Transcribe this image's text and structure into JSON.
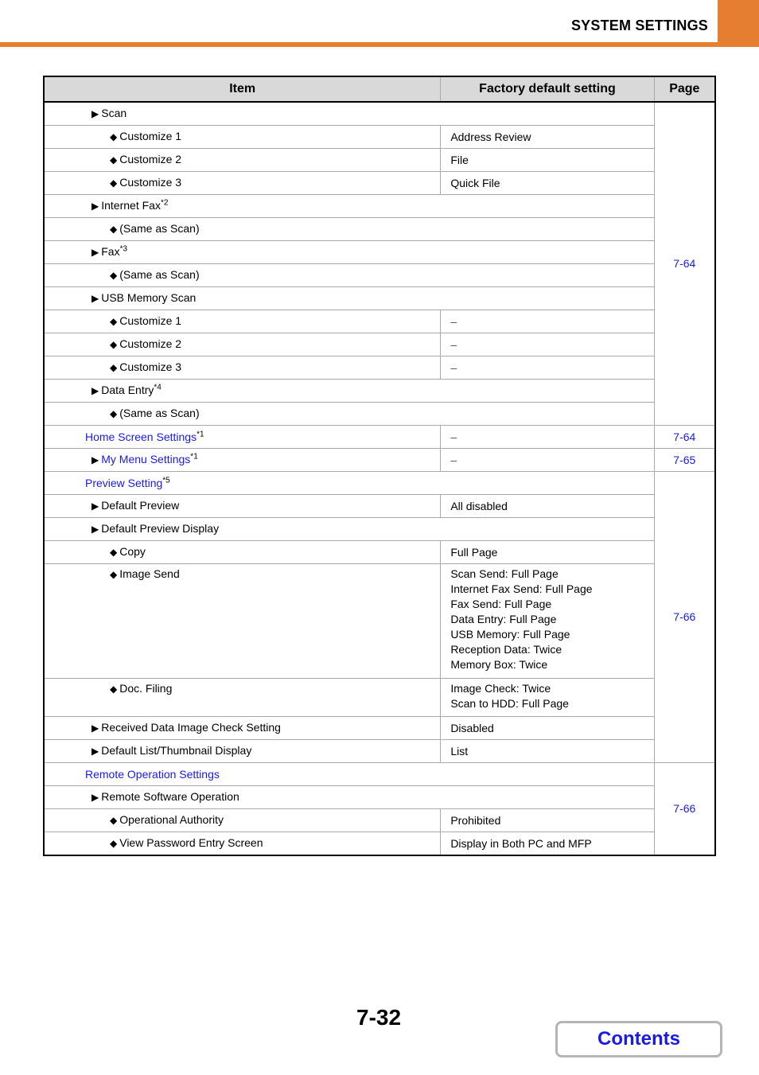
{
  "header": {
    "section_title": "SYSTEM SETTINGS",
    "accent_color": "#E67E31"
  },
  "table": {
    "columns": [
      "Item",
      "Factory default setting",
      "Page"
    ],
    "link_color": "#1A1AE6",
    "rows": [
      {
        "item": "Scan",
        "marker": "▶",
        "level": 1,
        "default": null,
        "page": "7-64"
      },
      {
        "item": "Customize 1",
        "marker": "◆",
        "level": 2,
        "default": "Address Review"
      },
      {
        "item": "Customize 2",
        "marker": "◆",
        "level": 2,
        "default": "File"
      },
      {
        "item": "Customize 3",
        "marker": "◆",
        "level": 2,
        "default": "Quick File"
      },
      {
        "item": "Internet Fax",
        "sup": "*2",
        "marker": "▶",
        "level": 1,
        "default": null
      },
      {
        "item": "(Same as Scan)",
        "marker": "◆",
        "level": 2,
        "default": null
      },
      {
        "item": "Fax",
        "sup": "*3",
        "marker": "▶",
        "level": 1,
        "default": null
      },
      {
        "item": "(Same as Scan)",
        "marker": "◆",
        "level": 2,
        "default": null
      },
      {
        "item": "USB Memory Scan",
        "marker": "▶",
        "level": 1,
        "default": null
      },
      {
        "item": "Customize 1",
        "marker": "◆",
        "level": 2,
        "default": "–"
      },
      {
        "item": "Customize 2",
        "marker": "◆",
        "level": 2,
        "default": "–"
      },
      {
        "item": "Customize 3",
        "marker": "◆",
        "level": 2,
        "default": "–"
      },
      {
        "item": "Data Entry",
        "sup": "*4",
        "marker": "▶",
        "level": 1,
        "default": null
      },
      {
        "item": "(Same as Scan)",
        "marker": "◆",
        "level": 2,
        "default": null
      },
      {
        "item": "Home Screen Settings",
        "sup": "*1",
        "level": 0,
        "link": true,
        "default": "–",
        "page": "7-64"
      },
      {
        "item": "My Menu Settings",
        "sup": "*1",
        "marker": "▶",
        "level": 1,
        "link": true,
        "default": "–",
        "page": "7-65"
      },
      {
        "item": "Preview Setting",
        "sup": "*5",
        "level": 0,
        "link": true,
        "default": null,
        "page": "7-66"
      },
      {
        "item": "Default Preview",
        "marker": "▶",
        "level": 1,
        "default": "All disabled"
      },
      {
        "item": "Default Preview Display",
        "marker": "▶",
        "level": 1,
        "default": null
      },
      {
        "item": "Copy",
        "marker": "◆",
        "level": 2,
        "default": "Full Page"
      },
      {
        "item": "Image Send",
        "marker": "◆",
        "level": 2,
        "default_lines": [
          "Scan Send: Full Page",
          "Internet Fax Send: Full Page",
          "Fax Send: Full Page",
          "Data Entry: Full Page",
          "USB Memory: Full Page",
          "Reception Data: Twice",
          "Memory Box: Twice"
        ]
      },
      {
        "item": "Doc. Filing",
        "marker": "◆",
        "level": 2,
        "default_lines": [
          "Image Check: Twice",
          "Scan to HDD: Full Page"
        ]
      },
      {
        "item": "Received Data Image Check Setting",
        "marker": "▶",
        "level": 1,
        "default": "Disabled"
      },
      {
        "item": "Default List/Thumbnail Display",
        "marker": "▶",
        "level": 1,
        "default": "List"
      },
      {
        "item": "Remote Operation Settings",
        "level": 0,
        "link": true,
        "default": null,
        "page": "7-66"
      },
      {
        "item": "Remote Software Operation",
        "marker": "▶",
        "level": 1,
        "default": null
      },
      {
        "item": "Operational Authority",
        "marker": "◆",
        "level": 2,
        "default": "Prohibited"
      },
      {
        "item": "View Password Entry Screen",
        "marker": "◆",
        "level": 2,
        "default": "Display in Both PC and MFP"
      }
    ]
  },
  "footer": {
    "page_number": "7-32",
    "contents_button": "Contents"
  }
}
